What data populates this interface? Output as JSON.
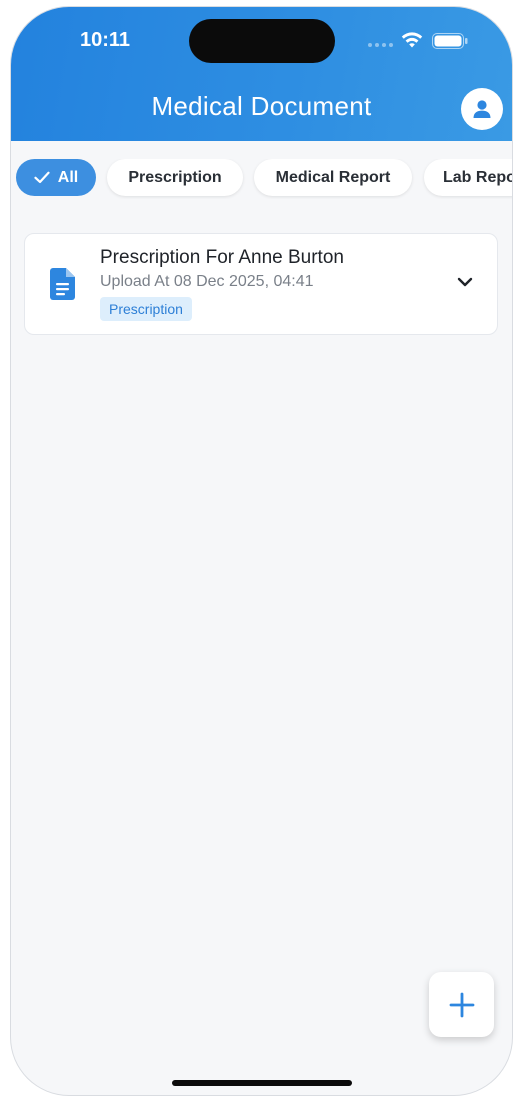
{
  "status_bar": {
    "time": "10:11"
  },
  "header": {
    "title": "Medical Document"
  },
  "filters": [
    {
      "label": "All",
      "active": true
    },
    {
      "label": "Prescription",
      "active": false
    },
    {
      "label": "Medical Report",
      "active": false
    },
    {
      "label": "Lab Repo",
      "active": false
    }
  ],
  "documents": [
    {
      "title": "Prescription For Anne Burton",
      "uploaded": "Upload At 08 Dec 2025, 04:41",
      "tag": "Prescription"
    }
  ],
  "colors": {
    "accent": "#2d86df",
    "tag_bg": "#ddeefc",
    "background": "#f6f7f9"
  },
  "icons": [
    "wifi-icon",
    "battery-icon",
    "user-icon",
    "check-icon",
    "document-icon",
    "chevron-down-icon",
    "plus-icon"
  ]
}
